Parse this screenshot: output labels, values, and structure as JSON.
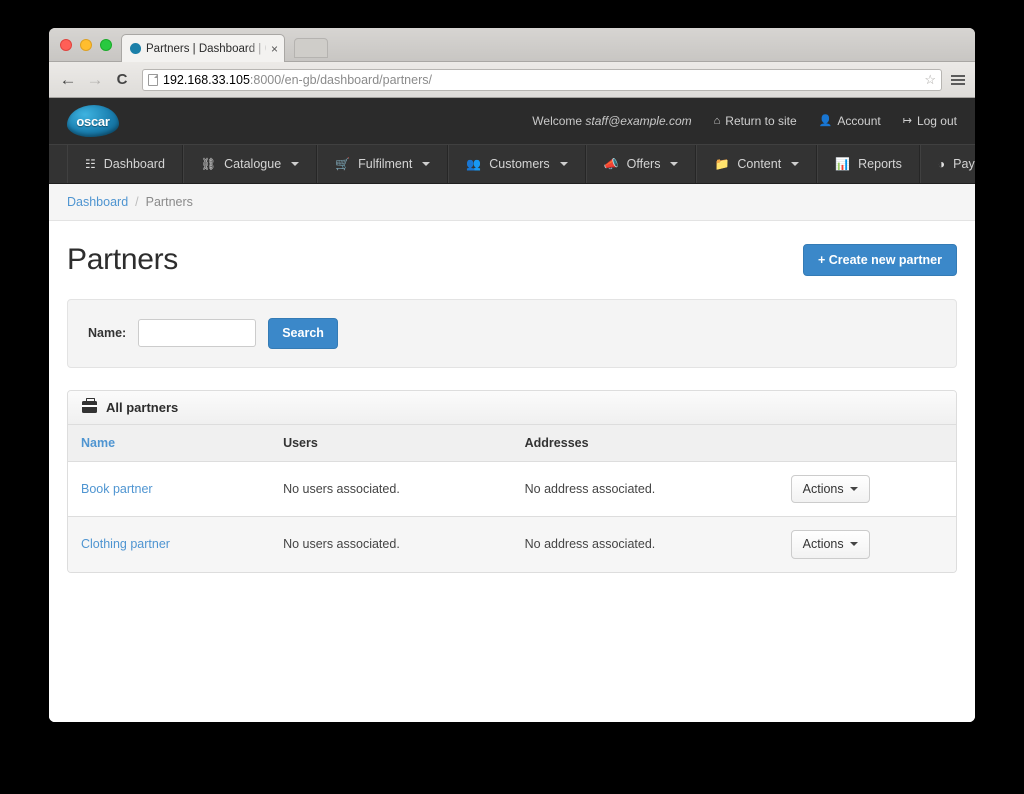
{
  "browser": {
    "tab_title": "Partners | Dashboard | Osc",
    "tab_close": "×",
    "back_icon": "←",
    "forward_icon": "→",
    "reload_icon": "C",
    "url_host": "192.168.33.105",
    "url_rest": ":8000/en-gb/dashboard/partners/",
    "star_icon": "☆"
  },
  "header": {
    "logo_text": "oscar",
    "welcome_prefix": "Welcome ",
    "welcome_email": "staff@example.com",
    "links": [
      {
        "label": "Return to site",
        "icon": "⌂"
      },
      {
        "label": "Account",
        "icon": "👤"
      },
      {
        "label": "Log out",
        "icon": "↦"
      }
    ]
  },
  "nav": {
    "items": [
      {
        "label": "Dashboard",
        "icon": "☷",
        "caret": false
      },
      {
        "label": "Catalogue",
        "icon": "⛓",
        "caret": true
      },
      {
        "label": "Fulfilment",
        "icon": "🛒",
        "caret": true
      },
      {
        "label": "Customers",
        "icon": "👥",
        "caret": true
      },
      {
        "label": "Offers",
        "icon": "📣",
        "caret": true
      },
      {
        "label": "Content",
        "icon": "📁",
        "caret": true
      },
      {
        "label": "Reports",
        "icon": "📊",
        "caret": false
      },
      {
        "label": "PayPal",
        "icon": "◑",
        "caret": true
      }
    ]
  },
  "breadcrumb": {
    "root_label": "Dashboard",
    "separator": "/",
    "current_label": "Partners"
  },
  "main": {
    "title": "Partners",
    "create_button_label": "+ Create new partner",
    "search": {
      "name_label": "Name:",
      "name_value": "",
      "name_placeholder": "",
      "search_button_label": "Search"
    },
    "panel": {
      "title": "All partners",
      "columns": [
        "Name",
        "Users",
        "Addresses",
        ""
      ],
      "rows": [
        {
          "name": "Book partner",
          "users": "No users associated.",
          "addresses": "No address associated.",
          "action_label": "Actions"
        },
        {
          "name": "Clothing partner",
          "users": "No users associated.",
          "addresses": "No address associated.",
          "action_label": "Actions"
        }
      ]
    }
  },
  "colors": {
    "accent": "#3b88c9",
    "link": "#4f95d1",
    "header_bg": "#2b2b2b",
    "nav_bg": "#333333"
  }
}
